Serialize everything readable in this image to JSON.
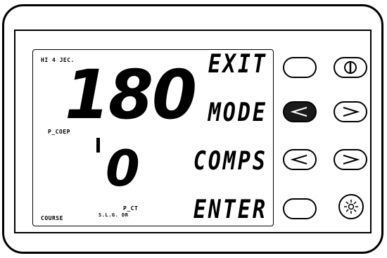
{
  "display": {
    "top_label": "HI 4 JEC.",
    "primary_value": "180",
    "primary_label": "P_COEP",
    "secondary_value": "0",
    "secondary_label_line1": "P_CT",
    "secondary_label_line2": "S.L.G. DR",
    "bottom_label": "COURSE"
  },
  "softkeys": [
    {
      "label": "EXIT"
    },
    {
      "label": "MODE"
    },
    {
      "label": "COMPS"
    },
    {
      "label": "ENTER"
    }
  ],
  "buttons": {
    "left": [
      {
        "icon": "blank",
        "state": "normal"
      },
      {
        "icon": "chevron-left",
        "state": "pressed"
      },
      {
        "icon": "chevron-left",
        "state": "normal"
      },
      {
        "icon": "blank",
        "state": "normal"
      }
    ],
    "right": [
      {
        "icon": "power-icon"
      },
      {
        "icon": "chevron-right"
      },
      {
        "icon": "chevron-right"
      },
      {
        "icon": "light-icon"
      }
    ]
  },
  "colors": {
    "ink": "#000000",
    "background": "#ffffff",
    "pressed": "#1a1a1a"
  }
}
